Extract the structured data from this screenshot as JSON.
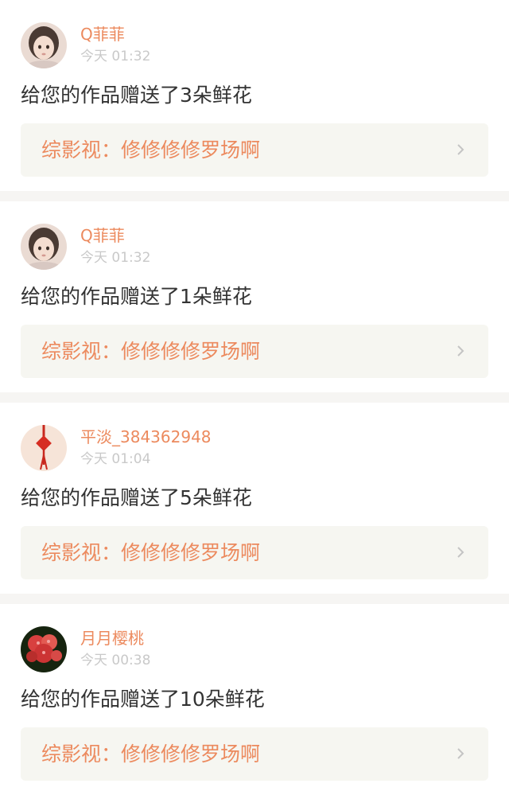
{
  "feed": [
    {
      "username": "Q菲菲",
      "time": "今天 01:32",
      "message": "给您的作品赠送了3朵鲜花",
      "work": "综影视：修修修修罗场啊",
      "avatar": "girl-portrait"
    },
    {
      "username": "Q菲菲",
      "time": "今天 01:32",
      "message": "给您的作品赠送了1朵鲜花",
      "work": "综影视：修修修修罗场啊",
      "avatar": "girl-portrait"
    },
    {
      "username": "平淡_384362948",
      "time": "今天 01:04",
      "message": "给您的作品赠送了5朵鲜花",
      "work": "综影视：修修修修罗场啊",
      "avatar": "chinese-knot"
    },
    {
      "username": "月月樱桃",
      "time": "今天 00:38",
      "message": "给您的作品赠送了10朵鲜花",
      "work": "综影视：修修修修罗场啊",
      "avatar": "red-flowers"
    }
  ],
  "colors": {
    "accent": "#ec8a5e",
    "muted": "#c9c9c9",
    "text": "#333333",
    "link_bg": "#f6f6f1",
    "separator": "#f6f5f3",
    "tab_indicator": "#f080a8"
  }
}
